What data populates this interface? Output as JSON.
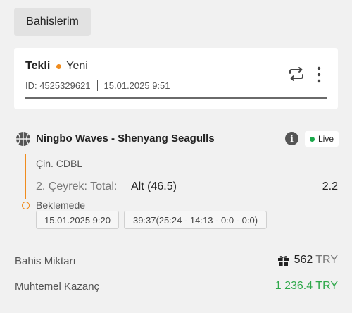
{
  "header": {
    "tab_label": "Bahislerim"
  },
  "ticket": {
    "type": "Tekli",
    "status": "Yeni",
    "id_text": "ID: 4525329621",
    "datetime": "15.01.2025 9:51",
    "repeat_icon": "repeat-icon",
    "more_icon": "more-vertical-icon"
  },
  "event": {
    "sport_icon": "basketball-icon",
    "name": "Ningbo Waves - Shenyang Seagulls",
    "info_label": "i",
    "live_label": "Live",
    "league": "Çin. CDBL",
    "market": "2. Çeyrek: Total:",
    "selection": "Alt (46.5)",
    "odds": "2.2",
    "pending_label": "Beklemede",
    "start_time": "15.01.2025 9:20",
    "score_info": "39:37(25:24 - 14:13 - 0:0 - 0:0)"
  },
  "summary": {
    "stake_label": "Bahis Miktarı",
    "stake_icon": "gift-icon",
    "stake_amount": "562",
    "stake_currency": "TRY",
    "win_label": "Muhtemel Kazanç",
    "win_value": "1 236.4 TRY"
  },
  "colors": {
    "accent_orange": "#f08c1e",
    "live_green": "#1aa84a",
    "win_green": "#2ea84a",
    "background": "#f1f1f1",
    "card": "#ffffff"
  }
}
